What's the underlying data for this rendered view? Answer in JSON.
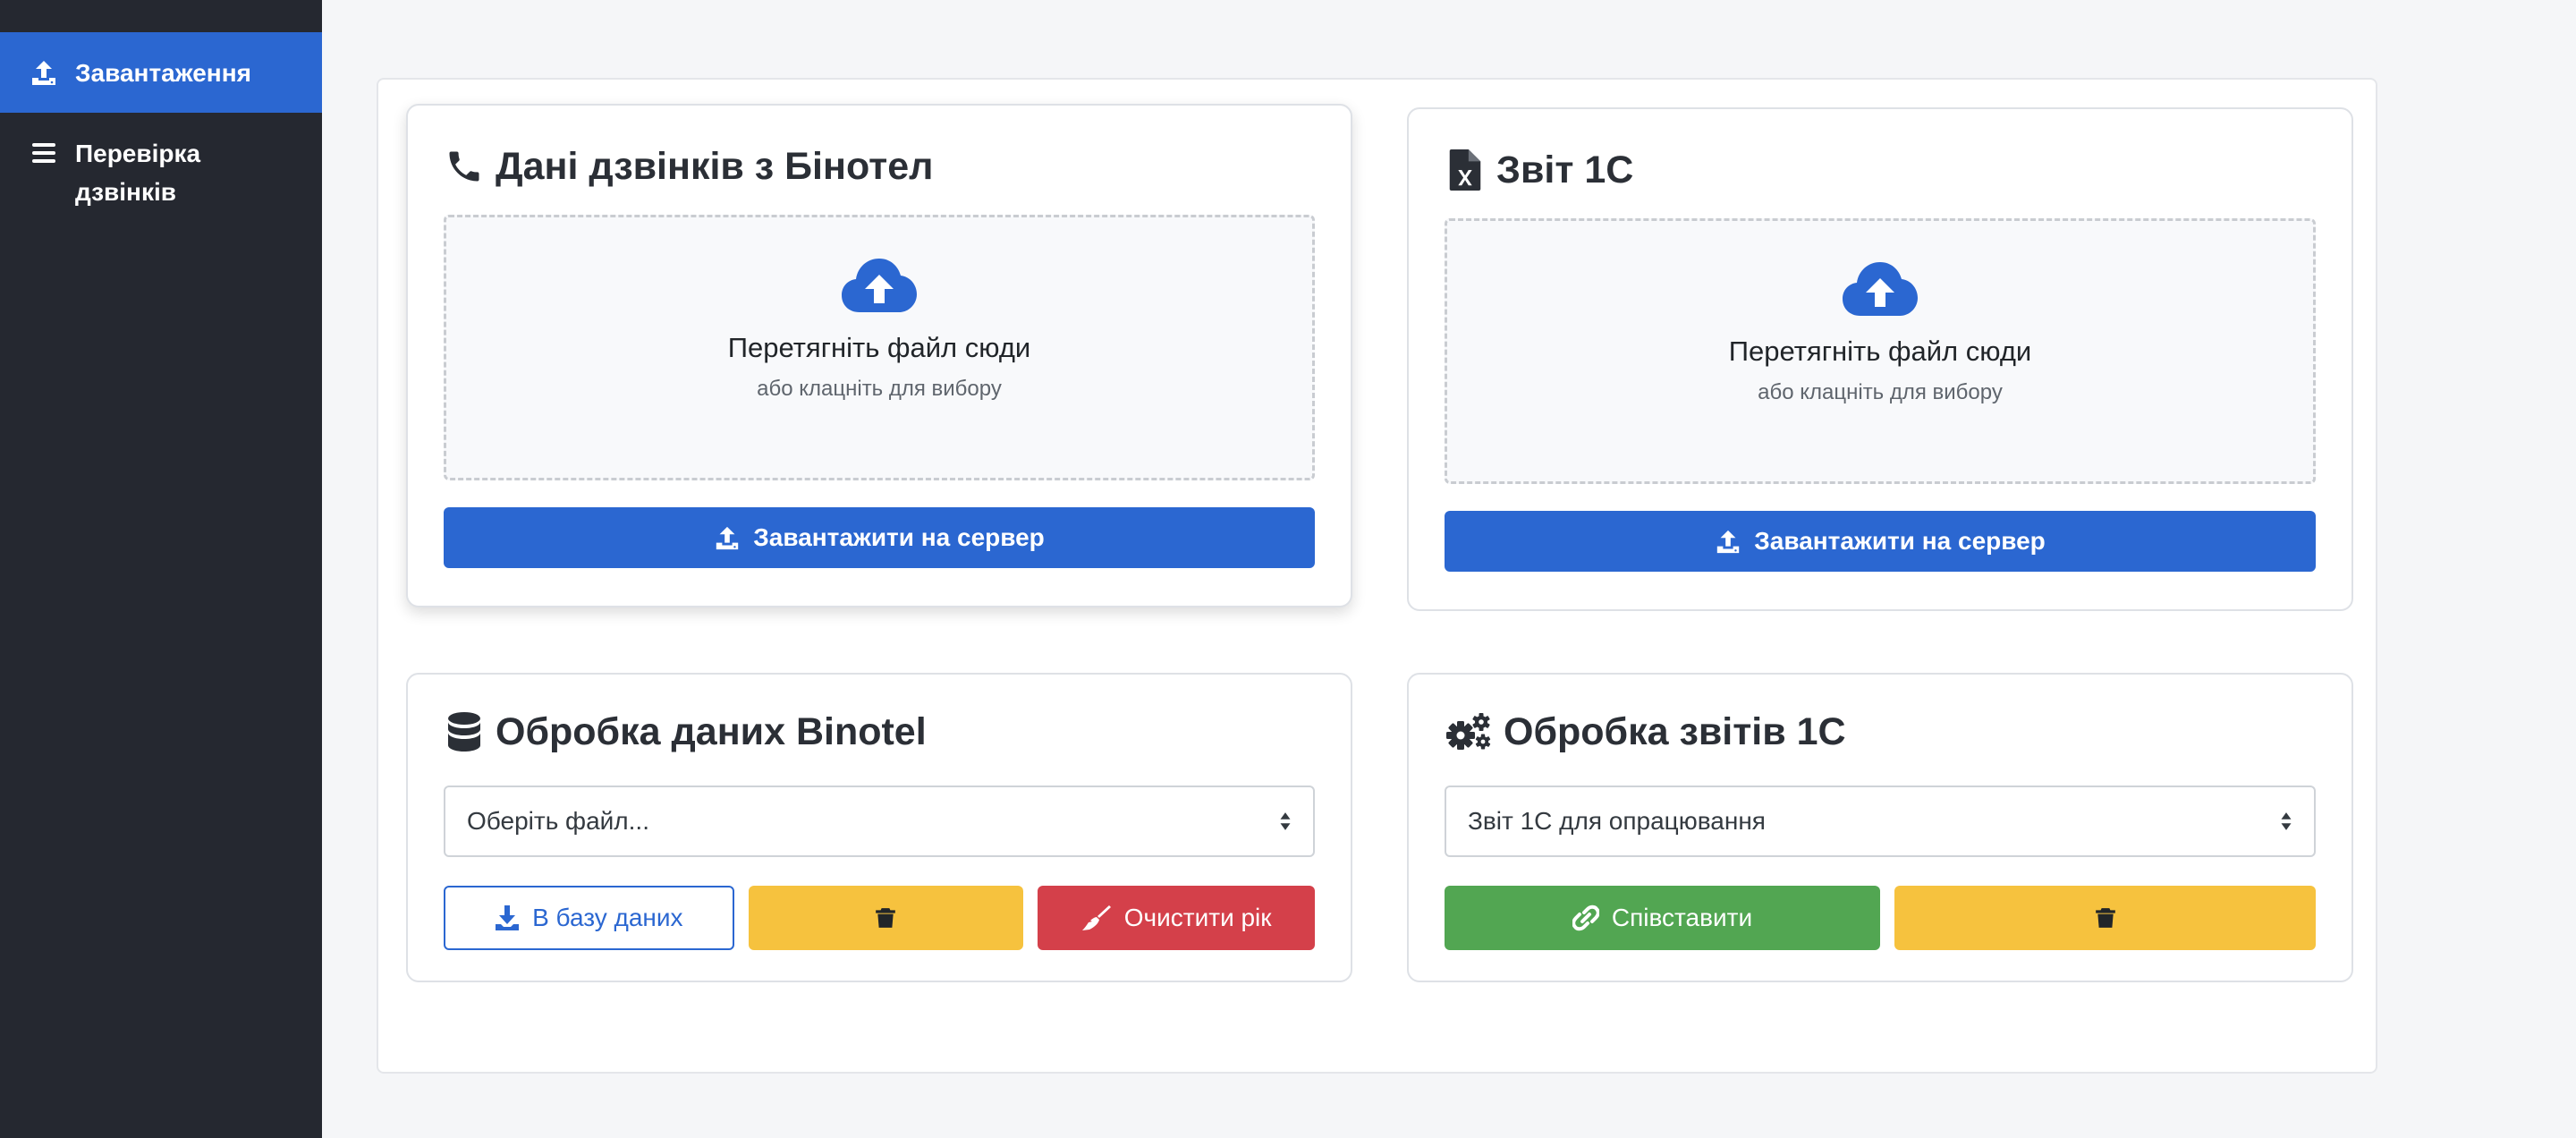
{
  "sidebar": {
    "items": [
      {
        "label": "Завантаження",
        "icon": "upload-icon",
        "active": true
      },
      {
        "label": "Перевірка\nдзвінків",
        "icon": "bars-icon",
        "active": false
      }
    ]
  },
  "cards": {
    "binotel_upload": {
      "title": "Дані дзвінків з Бінотел",
      "icon": "phone-icon",
      "dropzone_title": "Перетягніть файл сюди",
      "dropzone_sub": "або клацніть для вибору",
      "upload_label": "Завантажити на сервер"
    },
    "report_upload": {
      "title": "Звіт 1С",
      "icon": "file-excel-icon",
      "dropzone_title": "Перетягніть файл сюди",
      "dropzone_sub": "або клацніть для вибору",
      "upload_label": "Завантажити на сервер"
    },
    "binotel_process": {
      "title": "Обробка даних Binotel",
      "icon": "database-icon",
      "select_value": "Оберіть файл...",
      "db_label": "В базу даних",
      "clear_label": "Очистити рік"
    },
    "report_process": {
      "title": "Обробка звітів 1С",
      "icon": "cogs-icon",
      "select_value": "Звіт 1С для опрацювання",
      "match_label": "Співставити"
    }
  },
  "colors": {
    "primary": "#2b67d1",
    "warning": "#f6c23e",
    "danger": "#d4404a",
    "success": "#52a652",
    "sidebar": "#252830"
  }
}
